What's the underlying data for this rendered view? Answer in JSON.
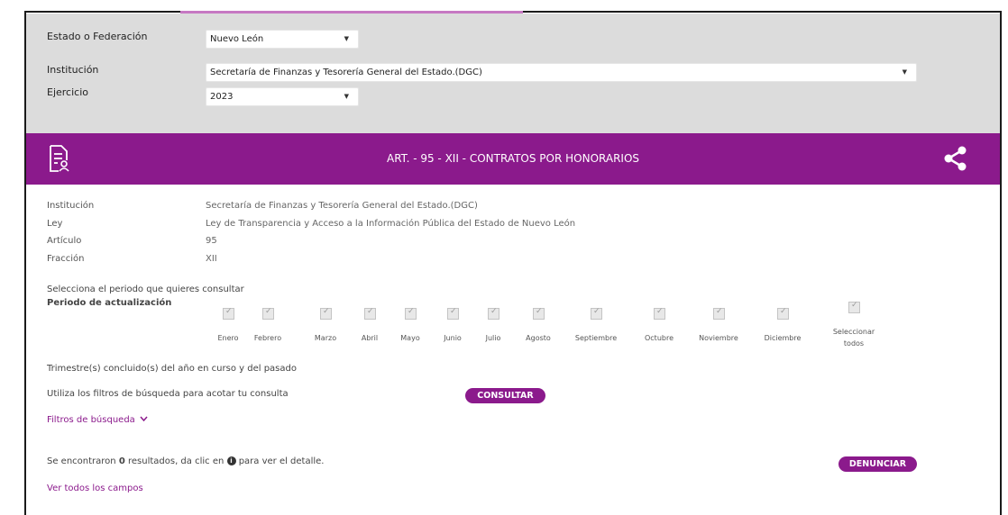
{
  "filters": {
    "estado_label": "Estado o Federación",
    "estado_value": "Nuevo León",
    "institucion_label": "Institución",
    "institucion_value": "Secretaría de Finanzas y Tesorería General del Estado.(DGC)",
    "ejercicio_label": "Ejercicio",
    "ejercicio_value": "2023"
  },
  "banner": {
    "title": "ART. - 95 - XII - CONTRATOS POR HONORARIOS",
    "icon_left": "document-user-icon",
    "icon_right": "share-icon",
    "color": "#8b1a8c"
  },
  "meta": {
    "institucion_label": "Institución",
    "institucion_value": "Secretaría de Finanzas y Tesorería General del Estado.(DGC)",
    "ley_label": "Ley",
    "ley_value": "Ley de Transparencia y Acceso a la Información Pública del Estado de Nuevo León",
    "articulo_label": "Artículo",
    "articulo_value": "95",
    "fraccion_label": "Fracción",
    "fraccion_value": "XII"
  },
  "periodo": {
    "prompt": "Selecciona el periodo que quieres consultar",
    "label": "Periodo de actualización",
    "months": [
      "Enero",
      "Febrero",
      "Marzo",
      "Abril",
      "Mayo",
      "Junio",
      "Julio",
      "Agosto",
      "Septiembre",
      "Octubre",
      "Noviembre",
      "Diciembre"
    ],
    "select_all": "Seleccionar todos"
  },
  "trimestres_text": "Trimestre(s) concluido(s) del año en curso y del pasado",
  "filtros_hint": "Utiliza los filtros de búsqueda para acotar tu consulta",
  "consultar_label": "CONSULTAR",
  "filtros_toggle": "Filtros de búsqueda",
  "results": {
    "prefix": "Se encontraron",
    "count": "0",
    "suffix_a": "resultados, da clic en",
    "suffix_b": "para ver el detalle.",
    "info_icon": "info-circle-icon"
  },
  "denunciar_label": "DENUNCIAR",
  "ver_todos": "Ver todos los campos"
}
